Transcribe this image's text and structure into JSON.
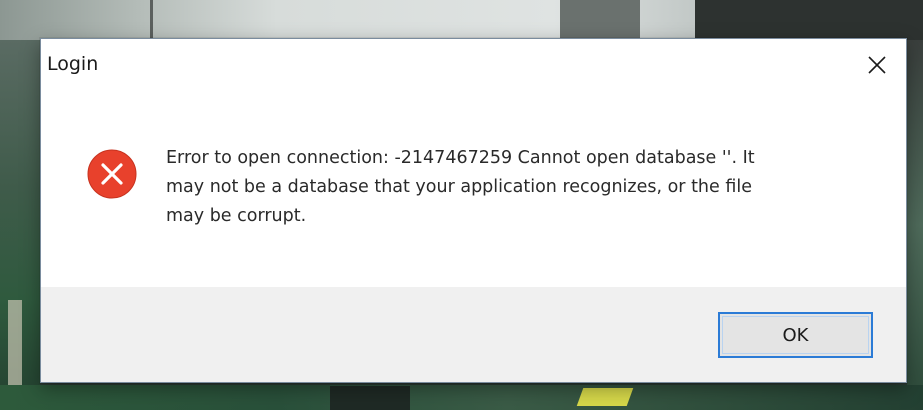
{
  "dialog": {
    "title": "Login",
    "message": "Error to open connection: -2147467259 Cannot open database ''.  It\nmay not be a database that your application recognizes, or the file\nmay be corrupt.",
    "icon": "error-icon",
    "ok_label": "OK"
  },
  "colors": {
    "error_red": "#e8412c",
    "focus_border": "#2b7bd6",
    "footer_bg": "#f0f0f0"
  }
}
